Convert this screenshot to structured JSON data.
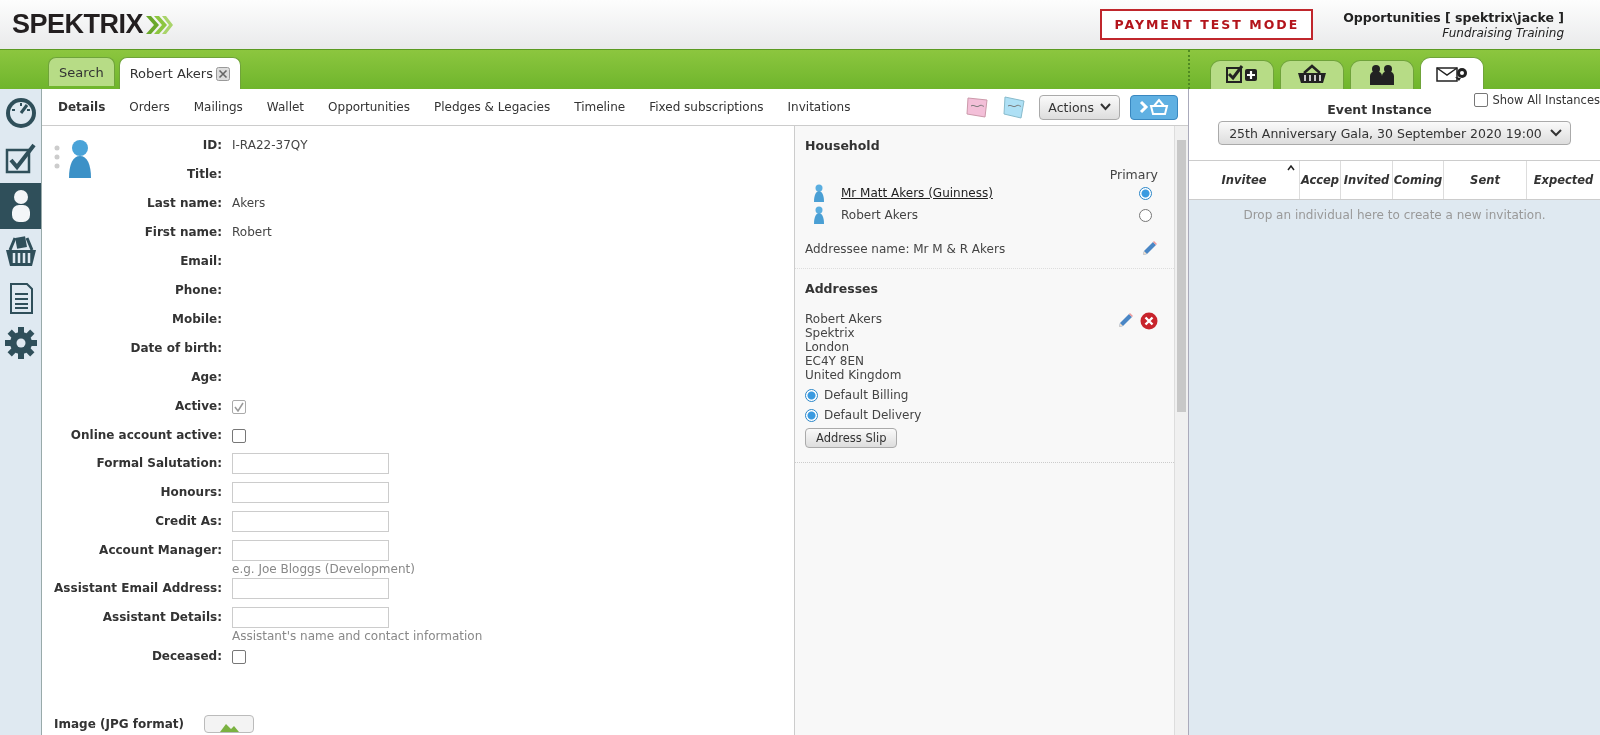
{
  "header": {
    "logo": "SPEKTRIX",
    "mode_badge": "PAYMENT TEST MODE",
    "user": "Opportunities [ spektrix\\jacke ]",
    "context": "Fundraising Training"
  },
  "tabs": [
    {
      "label": "Search",
      "selected": false,
      "closable": false
    },
    {
      "label": "Robert Akers",
      "selected": true,
      "closable": true
    }
  ],
  "right_tabs": [
    {
      "kind": "tasks",
      "selected": false
    },
    {
      "kind": "basket",
      "selected": false
    },
    {
      "kind": "people",
      "selected": false
    },
    {
      "kind": "mail",
      "selected": true
    }
  ],
  "sidebar": {
    "items": [
      {
        "kind": "dashboard",
        "selected": false
      },
      {
        "kind": "tasks",
        "selected": false
      },
      {
        "kind": "person",
        "selected": true
      },
      {
        "kind": "basket",
        "selected": false
      },
      {
        "kind": "document",
        "selected": false
      },
      {
        "kind": "settings",
        "selected": false
      }
    ]
  },
  "subtabs": [
    {
      "label": "Details",
      "selected": true
    },
    {
      "label": "Orders",
      "selected": false
    },
    {
      "label": "Mailings",
      "selected": false
    },
    {
      "label": "Wallet",
      "selected": false
    },
    {
      "label": "Opportunities",
      "selected": false
    },
    {
      "label": "Pledges & Legacies",
      "selected": false
    },
    {
      "label": "Timeline",
      "selected": false
    },
    {
      "label": "Fixed subscriptions",
      "selected": false
    },
    {
      "label": "Invitations",
      "selected": false
    }
  ],
  "toolbar": {
    "actions": "Actions"
  },
  "details": [
    {
      "kind": "text",
      "label": "ID:",
      "value": "I-RA22-37QY"
    },
    {
      "kind": "text",
      "label": "Title:"
    },
    {
      "kind": "text",
      "label": "Last name:",
      "value": "Akers"
    },
    {
      "kind": "text",
      "label": "First name:",
      "value": "Robert"
    },
    {
      "kind": "text",
      "label": "Email:"
    },
    {
      "kind": "text",
      "label": "Phone:"
    },
    {
      "kind": "text",
      "label": "Mobile:"
    },
    {
      "kind": "text",
      "label": "Date of birth:"
    },
    {
      "kind": "text",
      "label": "Age:"
    },
    {
      "kind": "checkbox",
      "label": "Active:",
      "checked": true,
      "disabled": true
    },
    {
      "kind": "checkbox",
      "label": "Online account active:",
      "checked": false,
      "disabled": false
    },
    {
      "kind": "input",
      "label": "Formal Salutation:"
    },
    {
      "kind": "input",
      "label": "Honours:"
    },
    {
      "kind": "input",
      "label": "Credit As:"
    },
    {
      "kind": "input",
      "label": "Account Manager:",
      "hint": "e.g. Joe Bloggs (Development)"
    },
    {
      "kind": "input",
      "label": "Assistant Email Address:"
    },
    {
      "kind": "input",
      "label": "Assistant Details:",
      "hint": "Assistant's name and contact information"
    },
    {
      "kind": "checkbox",
      "label": "Deceased:",
      "checked": false,
      "disabled": false
    }
  ],
  "image_upload": {
    "label": "Image (JPG format)"
  },
  "household": {
    "title": "Household",
    "primary_heading": "Primary",
    "members": [
      {
        "name": "Mr Matt Akers (Guinness)",
        "link": true,
        "selected": true
      },
      {
        "name": "Robert Akers",
        "link": false,
        "selected": false
      }
    ],
    "addressee": "Addressee name: Mr M & R Akers"
  },
  "addresses": {
    "title": "Addresses",
    "lines": [
      "Robert Akers",
      "Spektrix",
      "London",
      "EC4Y 8EN",
      "United Kingdom"
    ],
    "options": [
      {
        "label": "Default Billing",
        "checked": true
      },
      {
        "label": "Default Delivery",
        "checked": true
      }
    ],
    "button": "Address Slip"
  },
  "event_panel": {
    "title": "Event Instance",
    "show_all": {
      "label": "Show All Instances",
      "checked": false
    },
    "instance": "25th Anniversary Gala, 30 September 2020 19:00",
    "columns": [
      {
        "label": "Invitee",
        "sorted": true
      },
      {
        "label": "Accep",
        "sorted": false
      },
      {
        "label": "Invited",
        "sorted": false
      },
      {
        "label": "Coming",
        "sorted": false
      },
      {
        "label": "Sent",
        "sorted": false
      },
      {
        "label": "Expected",
        "sorted": false
      }
    ],
    "empty_message": "Drop an individual here to create a new invitation."
  }
}
